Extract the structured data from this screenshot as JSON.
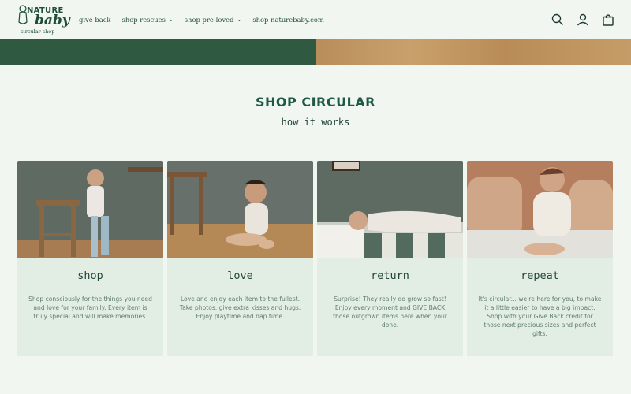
{
  "logo": {
    "line1": "NATURE",
    "line2": "baby",
    "line3": "circular shop"
  },
  "nav": [
    {
      "label": "give back"
    },
    {
      "label": "shop rescues",
      "chevron": "chevron-down-icon"
    },
    {
      "label": "shop pre-loved",
      "chevron": "chevron-down-icon"
    },
    {
      "label": "shop naturebaby.com"
    }
  ],
  "header_icons": [
    "search-icon",
    "account-icon",
    "bag-icon"
  ],
  "colors": {
    "brand": "#1f4d3a",
    "background": "#f1f6f1",
    "card": "#e2ede4"
  },
  "section": {
    "title": "SHOP CIRCULAR",
    "subtitle": "how it works"
  },
  "cards": [
    {
      "title": "shop",
      "text": "Shop consciously for the things you need and love for your family. Every item is truly special and will make memories."
    },
    {
      "title": "love",
      "text": "Love and enjoy each item to the fullest. Take photos, give extra kisses and hugs. Enjoy playtime and nap time."
    },
    {
      "title": "return",
      "text": "Surprise! They really do grow so fast! Enjoy every moment and GIVE BACK those outgrown items here when your done."
    },
    {
      "title": "repeat",
      "text": "It's circular... we're here for you, to make it a little easier to have a big impact. Shop with your Give Back credit for those next precious sizes and perfect gifts."
    }
  ]
}
